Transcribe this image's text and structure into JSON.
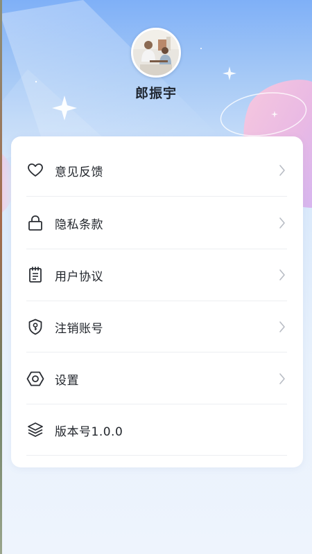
{
  "profile": {
    "name": "郎振宇",
    "avatar_icon": "user-avatar-photo"
  },
  "menu": {
    "items": [
      {
        "label": "意见反馈",
        "icon": "heart-icon",
        "has_chevron": true
      },
      {
        "label": "隐私条款",
        "icon": "lock-icon",
        "has_chevron": true
      },
      {
        "label": "用户协议",
        "icon": "notepad-icon",
        "has_chevron": true
      },
      {
        "label": "注销账号",
        "icon": "shield-key-icon",
        "has_chevron": true
      },
      {
        "label": "设置",
        "icon": "hexagon-settings-icon",
        "has_chevron": true
      },
      {
        "label": "版本号1.0.0",
        "icon": "layers-icon",
        "has_chevron": false
      }
    ]
  },
  "colors": {
    "background_top": "#7fb0f7",
    "background_bottom": "#eef4fd",
    "card": "#ffffff",
    "text": "#22262c",
    "icon": "#2a2d33",
    "chevron": "#b8bcc4"
  }
}
